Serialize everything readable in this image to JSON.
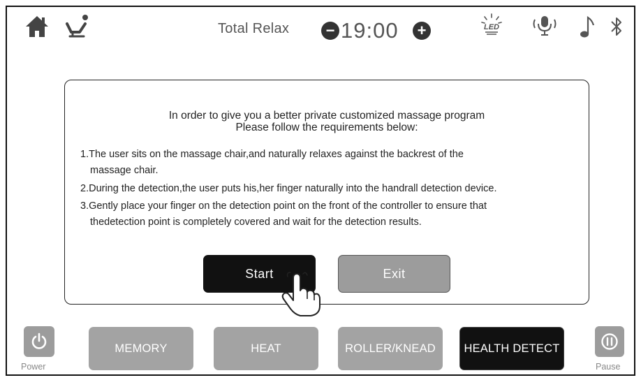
{
  "header": {
    "home_icon": "home-icon",
    "chair_icon": "recline-chair-icon",
    "program": "Total Relax",
    "time": "19:00",
    "minus": "−",
    "plus": "+",
    "status_icons": [
      "led-light-icon",
      "voice-microphone-icon",
      "music-note-icon",
      "bluetooth-icon"
    ],
    "led_text": "LED"
  },
  "dialog": {
    "title_line1": "In order to give you a better private customized massage program",
    "title_line2": "Please follow the requirements below:",
    "req1_line1": "1.The user sits on the massage chair,and naturally relaxes against the backrest of the",
    "req1_line2": "massage chair.",
    "req2": "2.During the detection,the user puts his,her finger naturally into the handrall detection device.",
    "req3_line1": "3.Gently place your finger on the detection point on the front of the controller to ensure that",
    "req3_line2": "thedetection point is completely covered and wait for the detection results.",
    "start_label": "Start",
    "exit_label": "Exit"
  },
  "bottom": {
    "power_label": "Power",
    "pause_label": "Pause",
    "modes": [
      "MEMORY",
      "HEAT",
      "ROLLER/KNEAD",
      "HEALTH DETECT"
    ],
    "active_mode": "HEALTH DETECT"
  },
  "colors": {
    "active": "#111111",
    "inactive": "#a3a3a3",
    "text_gray": "#555555"
  }
}
